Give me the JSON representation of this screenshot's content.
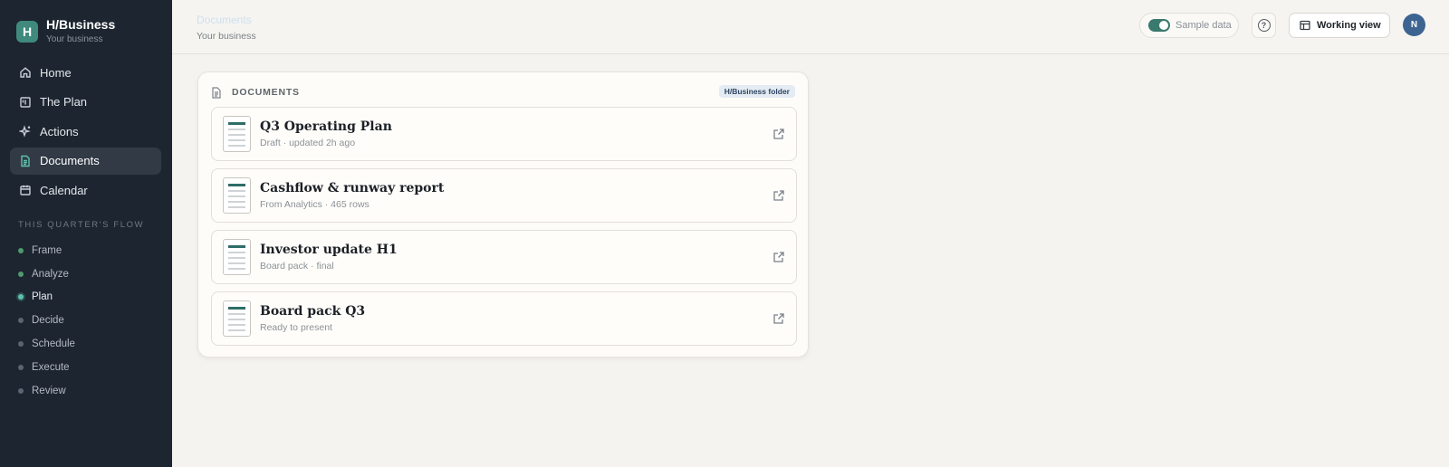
{
  "brand": {
    "logo_letter": "H",
    "name": "H/Business",
    "subtitle": "Your business"
  },
  "sidebar": {
    "nav": [
      {
        "label": "Home",
        "icon": "home-icon"
      },
      {
        "label": "The Plan",
        "icon": "plan-board-icon"
      },
      {
        "label": "Actions",
        "icon": "sparkle-icon"
      },
      {
        "label": "Documents",
        "icon": "document-icon",
        "active": true
      },
      {
        "label": "Calendar",
        "icon": "calendar-icon"
      }
    ],
    "flow_heading": "THIS QUARTER'S FLOW",
    "flow": [
      {
        "label": "Frame",
        "state": "done"
      },
      {
        "label": "Analyze",
        "state": "done"
      },
      {
        "label": "Plan",
        "state": "current"
      },
      {
        "label": "Decide",
        "state": "pending"
      },
      {
        "label": "Schedule",
        "state": "pending"
      },
      {
        "label": "Execute",
        "state": "pending"
      },
      {
        "label": "Review",
        "state": "pending"
      }
    ]
  },
  "header": {
    "breadcrumb": "Documents",
    "subtitle": "Your business",
    "sample_data_label": "Sample data",
    "sample_data_on": true,
    "help_icon": "question-icon",
    "view_button_label": "Working view",
    "avatar_initial": "N"
  },
  "documents": {
    "title": "DOCUMENTS",
    "folder_badge": "H/Business folder",
    "items": [
      {
        "title": "Q3 Operating Plan",
        "subtitle": "Draft · updated 2h ago"
      },
      {
        "title": "Cashflow & runway report",
        "subtitle": "From Analytics · 465 rows"
      },
      {
        "title": "Investor update H1",
        "subtitle": "Board pack · final"
      },
      {
        "title": "Board pack Q3",
        "subtitle": "Ready to present"
      }
    ]
  },
  "colors": {
    "sidebar_bg": "#1d2530",
    "accent": "#3f8a7c",
    "active_dot": "#5ec2ab",
    "avatar": "#3d6491"
  }
}
